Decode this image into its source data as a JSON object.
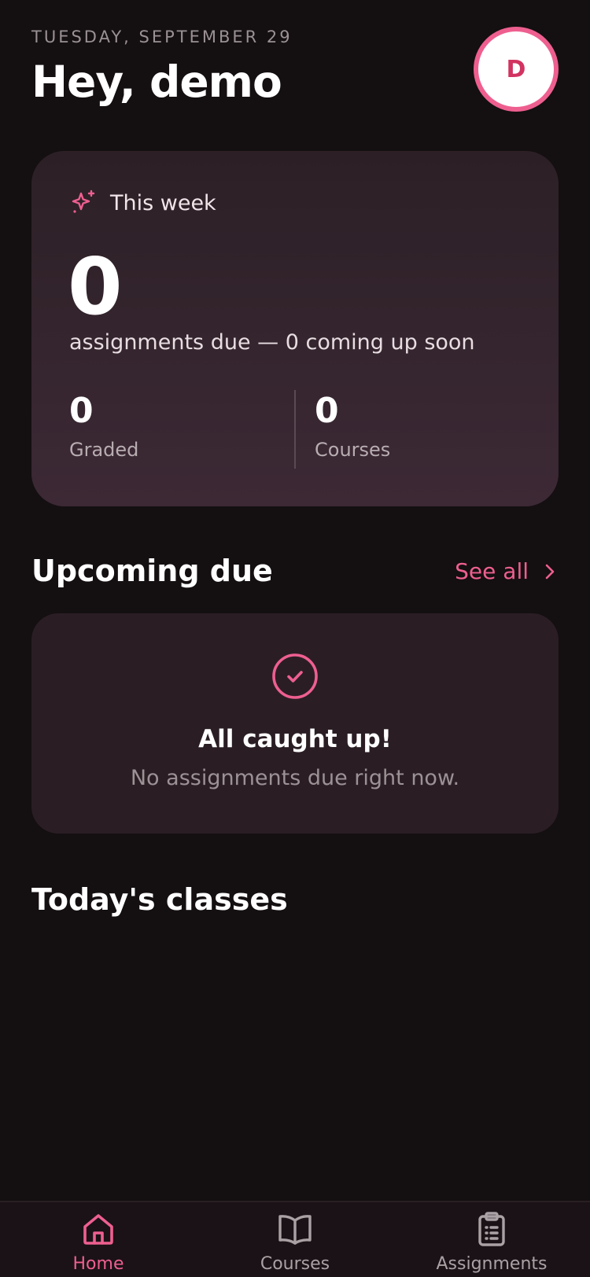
{
  "header": {
    "date": "TUESDAY, SEPTEMBER 29",
    "greeting": "Hey, demo",
    "avatar_initial": "D"
  },
  "week_card": {
    "label": "This week",
    "assignments_due_count": "0",
    "subtitle": "assignments due — 0 coming up soon",
    "stats": [
      {
        "value": "0",
        "label": "Graded"
      },
      {
        "value": "0",
        "label": "Courses"
      }
    ],
    "icon": "sparkle-icon"
  },
  "upcoming": {
    "title": "Upcoming due",
    "see_all_label": "See all",
    "empty_title": "All caught up!",
    "empty_subtitle": "No assignments due right now.",
    "empty_icon": "check-circle-icon"
  },
  "today": {
    "title": "Today's classes"
  },
  "bottom_nav": {
    "items": [
      {
        "label": "Home",
        "icon": "home-icon",
        "active": true
      },
      {
        "label": "Courses",
        "icon": "book-icon",
        "active": false
      },
      {
        "label": "Assignments",
        "icon": "clipboard-icon",
        "active": false
      }
    ]
  },
  "colors": {
    "accent": "#ee5f90",
    "background": "#140f11",
    "card": "#2a1e24",
    "muted_text": "#9c9296"
  }
}
